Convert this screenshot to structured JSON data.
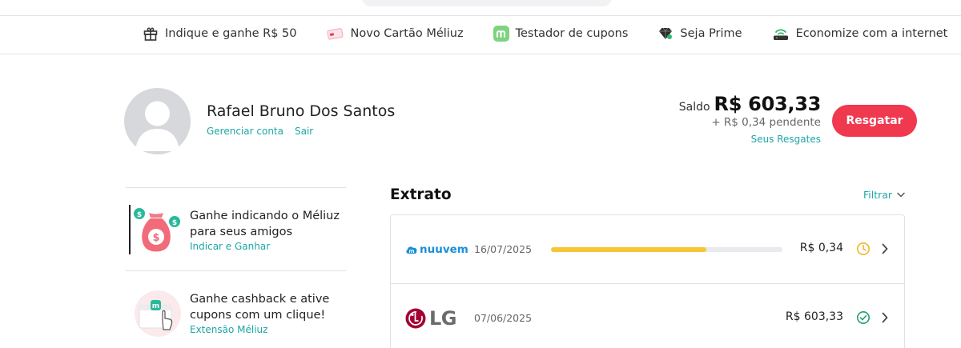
{
  "nav": {
    "items": [
      {
        "label": "Indique e ganhe R$ 50",
        "icon": "gift-icon"
      },
      {
        "label": "Novo Cartão Méliuz",
        "icon": "credit-card-icon"
      },
      {
        "label": "Testador de cupons",
        "icon": "meliuz-m-icon"
      },
      {
        "label": "Seja Prime",
        "icon": "diamond-icon"
      },
      {
        "label": "Economize com a internet",
        "icon": "router-icon"
      }
    ]
  },
  "profile": {
    "name": "Rafael Bruno Dos Santos",
    "manage_label": "Gerenciar conta",
    "logout_label": "Sair"
  },
  "balance": {
    "label": "Saldo",
    "value": "R$ 603,33",
    "pending": "+ R$ 0,34 pendente",
    "history_link": "Seus Resgates",
    "redeem_label": "Resgatar"
  },
  "promos": [
    {
      "title": "Ganhe indicando o Méliuz para seus amigos",
      "link": "Indicar e Ganhar",
      "icon": "money-bag-icon"
    },
    {
      "title": "Ganhe cashback e ative cupons com um clique!",
      "link": "Extensão Méliuz",
      "icon": "browser-extension-icon"
    }
  ],
  "extrato": {
    "title": "Extrato",
    "filter_label": "Filtrar",
    "rows": [
      {
        "store": "nuuvem",
        "date": "16/07/2025",
        "amount": "R$ 0,34",
        "status": "pending",
        "progress": 0.67
      },
      {
        "store": "LG",
        "date": "07/06/2025",
        "amount": "R$ 603,33",
        "status": "confirmed"
      }
    ]
  },
  "colors": {
    "accent": "#1ea6a6",
    "redeem_button": "#f0384f",
    "progress_fill": "#f6c636",
    "pending_icon": "#f2b62c",
    "confirmed_icon": "#22a06b",
    "lg_red": "#a50034"
  }
}
